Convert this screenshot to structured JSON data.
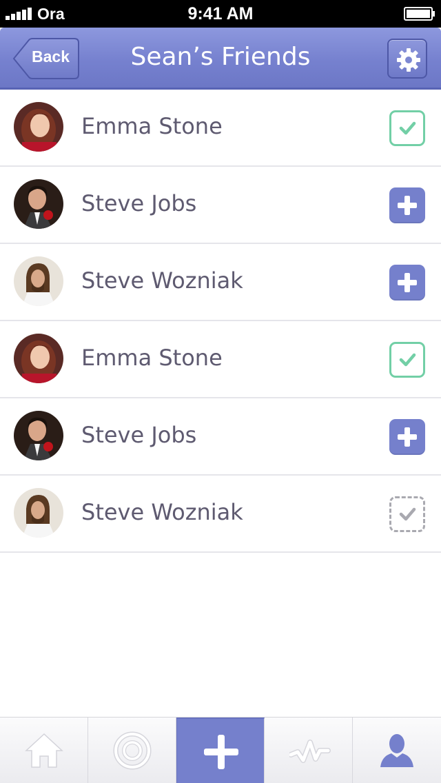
{
  "status_bar": {
    "carrier": "Ora",
    "time": "9:41 AM",
    "signal_bars": 5,
    "battery_level": 0.9
  },
  "nav_bar": {
    "back_label": "Back",
    "title": "Sean’s Friends",
    "settings_icon": "gear-icon"
  },
  "friends": [
    {
      "name": "Emma Stone",
      "status": "added",
      "icon": "check-icon"
    },
    {
      "name": "Steve Jobs",
      "status": "add",
      "icon": "plus-icon"
    },
    {
      "name": "Steve Wozniak",
      "status": "add",
      "icon": "plus-icon"
    },
    {
      "name": "Emma Stone",
      "status": "added",
      "icon": "check-icon"
    },
    {
      "name": "Steve Jobs",
      "status": "add",
      "icon": "plus-icon"
    },
    {
      "name": "Steve Wozniak",
      "status": "pending",
      "icon": "check-icon"
    }
  ],
  "tab_bar": {
    "tabs": [
      {
        "icon": "home-icon",
        "active": false
      },
      {
        "icon": "target-icon",
        "active": false
      },
      {
        "icon": "plus-icon",
        "active": true
      },
      {
        "icon": "activity-icon",
        "active": false
      },
      {
        "icon": "profile-icon",
        "active": false
      }
    ]
  },
  "colors": {
    "accent": "#7580cc",
    "added_green": "#72cfa6",
    "pending_gray": "#a9a9b0",
    "name_text": "#5e5a70"
  }
}
